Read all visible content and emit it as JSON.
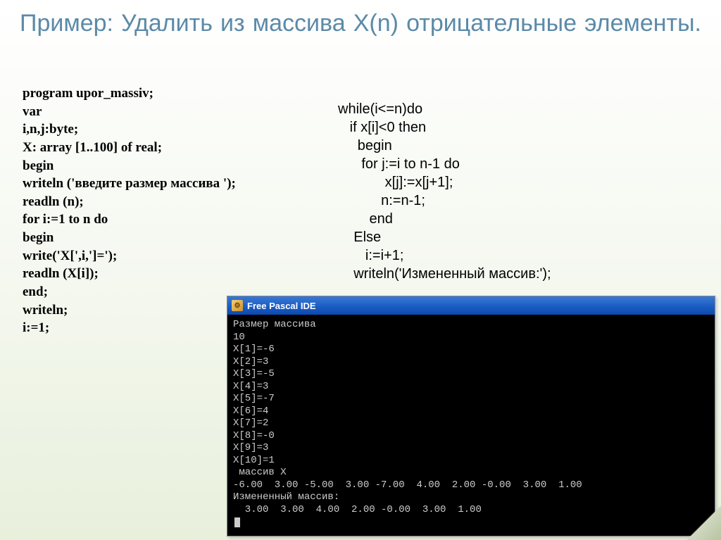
{
  "title": "Пример: Удалить из массива X(n) отрицательные элементы.",
  "code_left": "program upor_massiv;\nvar\ni,n,j:byte;\nX: array [1..100] of real;\nbegin\nwriteln ('введите размер массива ');\nreadln (n);\nfor i:=1 to n do\n  begin\n   write('X[',i,']=');\n   readln (X[i]);\nend;\nwriteln;\ni:=1;",
  "code_right": "while(i<=n)do\n   if x[i]<0 then\n     begin\n      for j:=i to n-1 do\n            x[j]:=x[j+1];\n           n:=n-1;\n        end\n    Else\n       i:=i+1;\n    writeln('Измененный массив:');",
  "ide": {
    "title": "Free Pascal IDE",
    "console": "Размер массива\n10\nX[1]=-6\nX[2]=3\nX[3]=-5\nX[4]=3\nX[5]=-7\nX[6]=4\nX[7]=2\nX[8]=-0\nX[9]=3\nX[10]=1\n массив X\n-6.00  3.00 -5.00  3.00 -7.00  4.00  2.00 -0.00  3.00  1.00\nИзмененный массив:\n  3.00  3.00  4.00  2.00 -0.00  3.00  1.00"
  }
}
